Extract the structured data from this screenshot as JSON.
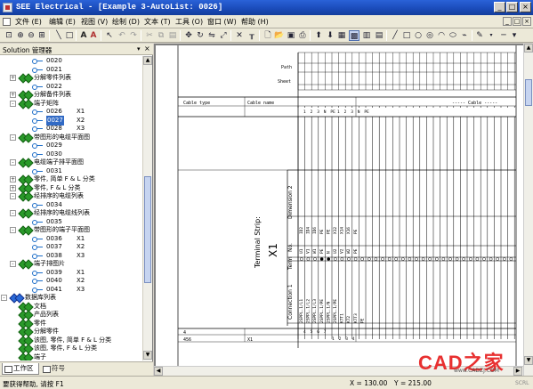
{
  "window": {
    "title": "SEE Electrical - [Example 3-AutoList: 0026]"
  },
  "menu": [
    "文件 (E)",
    "编辑 (E)",
    "视图 (V)",
    "绘制 (D)",
    "文本 (T)",
    "工具 (O)",
    "窗口 (W)",
    "帮助 (H)"
  ],
  "solution_panel": {
    "title": "Solution 管理器",
    "tree": [
      {
        "text": "0020",
        "icon": "wire",
        "level": 4
      },
      {
        "text": "0021",
        "icon": "wire",
        "level": 4
      },
      {
        "text": "分解零件列表",
        "icon": "group",
        "level": 3,
        "exp": "+"
      },
      {
        "text": "0022",
        "icon": "wire",
        "level": 4
      },
      {
        "text": "分解备件列表",
        "icon": "group",
        "level": 3,
        "exp": "+"
      },
      {
        "text": "端子矩阵",
        "icon": "group",
        "level": 3,
        "exp": "-"
      },
      {
        "text": "0026",
        "icon": "wire",
        "level": 4,
        "suffix": "X1"
      },
      {
        "text": "0027",
        "icon": "wire",
        "level": 4,
        "suffix": "X2",
        "selected": true
      },
      {
        "text": "0028",
        "icon": "wire",
        "level": 4,
        "suffix": "X3"
      },
      {
        "text": "带图形的电缆平面图",
        "icon": "group",
        "level": 3,
        "exp": "-"
      },
      {
        "text": "0029",
        "icon": "wire",
        "level": 4
      },
      {
        "text": "0030",
        "icon": "wire",
        "level": 4
      },
      {
        "text": "电缆端子排平面图",
        "icon": "group",
        "level": 3,
        "exp": "-"
      },
      {
        "text": "0031",
        "icon": "wire",
        "level": 4
      },
      {
        "text": "零件, 简单 F & L 分类",
        "icon": "group",
        "level": 3,
        "exp": "+"
      },
      {
        "text": "零件, F & L 分类",
        "icon": "group",
        "level": 3,
        "exp": "+"
      },
      {
        "text": "经排序的电缆列表",
        "icon": "group",
        "level": 3,
        "exp": "-"
      },
      {
        "text": "0034",
        "icon": "wire",
        "level": 4
      },
      {
        "text": "经排序的电缆线列表",
        "icon": "group",
        "level": 3,
        "exp": "-"
      },
      {
        "text": "0035",
        "icon": "wire",
        "level": 4
      },
      {
        "text": "带图形的端子平面图",
        "icon": "group",
        "level": 3,
        "exp": "-"
      },
      {
        "text": "0036",
        "icon": "wire",
        "level": 4,
        "suffix": "X1"
      },
      {
        "text": "0037",
        "icon": "wire",
        "level": 4,
        "suffix": "X2"
      },
      {
        "text": "0038",
        "icon": "wire",
        "level": 4,
        "suffix": "X3"
      },
      {
        "text": "端子排图片",
        "icon": "group",
        "level": 3,
        "exp": "-"
      },
      {
        "text": "0039",
        "icon": "wire",
        "level": 4,
        "suffix": "X1"
      },
      {
        "text": "0040",
        "icon": "wire",
        "level": 4,
        "suffix": "X2"
      },
      {
        "text": "0041",
        "icon": "wire",
        "level": 4,
        "suffix": "X3"
      },
      {
        "text": "数据库列表",
        "icon": "db",
        "level": 2,
        "exp": "-"
      },
      {
        "text": "文档",
        "icon": "group",
        "level": 3
      },
      {
        "text": "产品列表",
        "icon": "group",
        "level": 3
      },
      {
        "text": "零件",
        "icon": "group",
        "level": 3
      },
      {
        "text": "分解零件",
        "icon": "group",
        "level": 3
      },
      {
        "text": "该图, 零件, 简单 F & L 分类",
        "icon": "group",
        "level": 3
      },
      {
        "text": "该图, 零件, F & L 分类",
        "icon": "group",
        "level": 3
      },
      {
        "text": "端子",
        "icon": "group",
        "level": 3
      }
    ],
    "tabs": [
      "工作区",
      "符号"
    ]
  },
  "drawing": {
    "header_rows": [
      "Path",
      "Sheet"
    ],
    "cable_type_label": "Cable type",
    "cable_name_label": "Cable name",
    "cable_label": "----- Cable -----",
    "cable_cols": [
      "1",
      "2",
      "3",
      "N",
      "PE",
      "1",
      "2",
      "3",
      "N",
      "PE"
    ],
    "strip_title": "Terminal Strip:",
    "strip_name": "X1",
    "row_labels": [
      "Dimension 2",
      "No.",
      "Term",
      "Connection 1"
    ],
    "dim2_values": [
      "ID2",
      "ID4",
      "ID6",
      "PE",
      "PE",
      "X12",
      "X14",
      "X16",
      "PE"
    ],
    "no_values": [
      "U1",
      "V1",
      "W1",
      "PE",
      "N",
      "U2",
      "V2",
      "W2",
      "PE"
    ],
    "conn_values": [
      "2SPPL.1/L1",
      "2SPPL.1/L2",
      "2SPPL.1/L3",
      "2SPPL.1/PE",
      "2SPPL.1/N",
      "2SPPL.1/PE",
      "KTT1",
      "KT2",
      "KTT3",
      "PE"
    ],
    "bottom_left": "4",
    "bottom_code": "456",
    "bottom_x1": "X1",
    "bottom_nums": [
      "4",
      "5",
      "6",
      "7",
      "1",
      "2",
      "3",
      "4"
    ]
  },
  "status": {
    "help": "要获得帮助, 请按 F1",
    "x": "X = 130.00",
    "y": "Y = 215.00",
    "mode": "SCRL"
  },
  "watermark": {
    "logo": "CAD之家",
    "url": "www.CADZJ.COM"
  }
}
